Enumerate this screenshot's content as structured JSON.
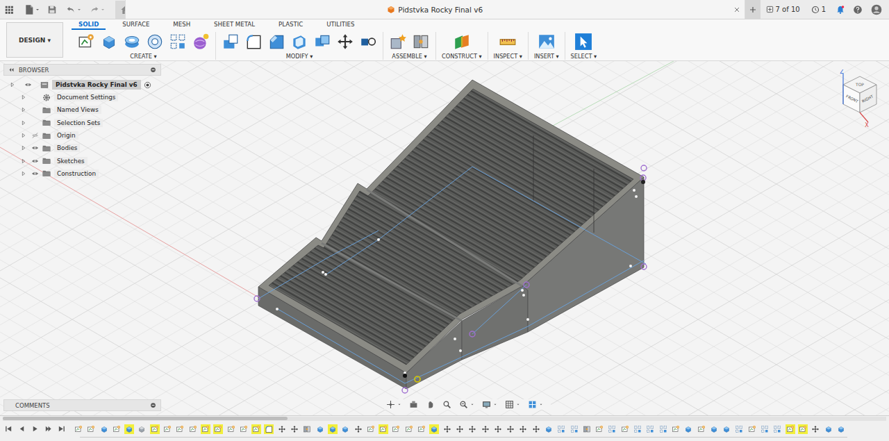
{
  "window": {
    "title": "Pidstvka Rocky Final v6"
  },
  "header": {
    "jobs": "7 of 10",
    "notifications": "1"
  },
  "workspace": {
    "label": "DESIGN ▾"
  },
  "tabs": [
    {
      "label": "SOLID",
      "selected": true
    },
    {
      "label": "SURFACE",
      "selected": false
    },
    {
      "label": "MESH",
      "selected": false
    },
    {
      "label": "SHEET METAL",
      "selected": false
    },
    {
      "label": "PLASTIC",
      "selected": false
    },
    {
      "label": "UTILITIES",
      "selected": false
    }
  ],
  "tool_groups": [
    {
      "label": "CREATE ▾"
    },
    {
      "label": "MODIFY ▾"
    },
    {
      "label": "ASSEMBLE ▾"
    },
    {
      "label": "CONSTRUCT ▾"
    },
    {
      "label": "INSPECT ▾"
    },
    {
      "label": "INSERT ▾"
    },
    {
      "label": "SELECT ▾"
    }
  ],
  "browser": {
    "title": "BROWSER",
    "root": {
      "label": "Pidstvka Rocky Final v6",
      "expanded": false,
      "visible": true,
      "active": true
    },
    "items": [
      {
        "label": "Document Settings",
        "kind": "settings",
        "expanded": false
      },
      {
        "label": "Named Views",
        "kind": "folder",
        "expanded": false
      },
      {
        "label": "Selection Sets",
        "kind": "folder",
        "expanded": false
      },
      {
        "label": "Origin",
        "kind": "folder",
        "expanded": false,
        "visible": false
      },
      {
        "label": "Bodies",
        "kind": "folder",
        "expanded": false,
        "visible": true
      },
      {
        "label": "Sketches",
        "kind": "folder",
        "expanded": false,
        "visible": true
      },
      {
        "label": "Construction",
        "kind": "folder",
        "expanded": false,
        "visible": true
      }
    ]
  },
  "comments": {
    "title": "COMMENTS"
  },
  "view_cube": {
    "top": "TOP",
    "front": "FRONT",
    "right": "RIGHT",
    "z": "Z",
    "x": "X"
  },
  "timeline": [
    {
      "kind": "sketch",
      "highlighted": false
    },
    {
      "kind": "sketch",
      "highlighted": false
    },
    {
      "kind": "extrude",
      "highlighted": false
    },
    {
      "kind": "sketch",
      "highlighted": false
    },
    {
      "kind": "extrude",
      "highlighted": true
    },
    {
      "kind": "body",
      "highlighted": false
    },
    {
      "kind": "sketch",
      "highlighted": true
    },
    {
      "kind": "sketch",
      "highlighted": false
    },
    {
      "kind": "sketch",
      "highlighted": false
    },
    {
      "kind": "sketch",
      "highlighted": false
    },
    {
      "kind": "sketch",
      "highlighted": true
    },
    {
      "kind": "sketch",
      "highlighted": true
    },
    {
      "kind": "sketch",
      "highlighted": false
    },
    {
      "kind": "sketch",
      "highlighted": false
    },
    {
      "kind": "sketch",
      "highlighted": true
    },
    {
      "kind": "fillet",
      "highlighted": true
    },
    {
      "kind": "move",
      "highlighted": false
    },
    {
      "kind": "move",
      "highlighted": false
    },
    {
      "kind": "joint",
      "highlighted": false
    },
    {
      "kind": "extrude",
      "highlighted": false
    },
    {
      "kind": "extrude",
      "highlighted": true
    },
    {
      "kind": "extrude",
      "highlighted": false
    },
    {
      "kind": "move",
      "highlighted": false
    },
    {
      "kind": "sketch",
      "highlighted": false
    },
    {
      "kind": "sketch",
      "highlighted": true
    },
    {
      "kind": "sketch",
      "highlighted": false
    },
    {
      "kind": "sketch",
      "highlighted": false
    },
    {
      "kind": "sketch",
      "highlighted": false
    },
    {
      "kind": "extrude",
      "highlighted": true
    },
    {
      "kind": "move",
      "highlighted": false
    },
    {
      "kind": "move",
      "highlighted": false
    },
    {
      "kind": "move",
      "highlighted": false
    },
    {
      "kind": "move",
      "highlighted": false
    },
    {
      "kind": "move",
      "highlighted": false
    },
    {
      "kind": "move",
      "highlighted": false
    },
    {
      "kind": "move",
      "highlighted": false
    },
    {
      "kind": "move",
      "highlighted": false
    },
    {
      "kind": "extrude",
      "highlighted": false
    },
    {
      "kind": "pattern",
      "highlighted": false
    },
    {
      "kind": "pattern",
      "highlighted": false
    },
    {
      "kind": "joint",
      "highlighted": false
    },
    {
      "kind": "sketch",
      "highlighted": false
    },
    {
      "kind": "pattern",
      "highlighted": false
    },
    {
      "kind": "sketch",
      "highlighted": false
    },
    {
      "kind": "pattern",
      "highlighted": false
    },
    {
      "kind": "pattern",
      "highlighted": false
    },
    {
      "kind": "pattern",
      "highlighted": false
    },
    {
      "kind": "sketch",
      "highlighted": false
    },
    {
      "kind": "extrude",
      "highlighted": false
    },
    {
      "kind": "sketch",
      "highlighted": false
    },
    {
      "kind": "extrude",
      "highlighted": false
    },
    {
      "kind": "extrude",
      "highlighted": false
    },
    {
      "kind": "pattern",
      "highlighted": false
    },
    {
      "kind": "sketch",
      "highlighted": false
    },
    {
      "kind": "pattern",
      "highlighted": false
    },
    {
      "kind": "pattern",
      "highlighted": false
    },
    {
      "kind": "sketch",
      "highlighted": true
    },
    {
      "kind": "sketch",
      "highlighted": true
    },
    {
      "kind": "move",
      "highlighted": false
    },
    {
      "kind": "extrude",
      "highlighted": false
    },
    {
      "kind": "extrude",
      "highlighted": false
    }
  ]
}
